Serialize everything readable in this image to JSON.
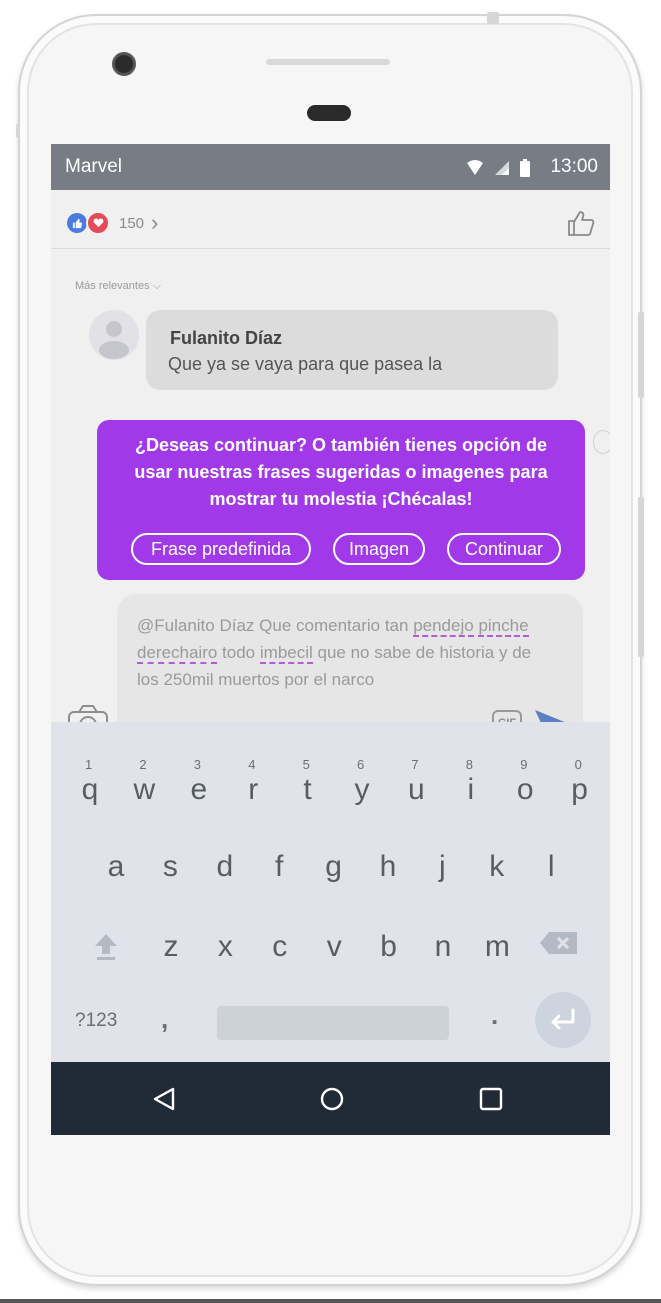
{
  "status_bar": {
    "carrier": "Marvel",
    "time": "13:00",
    "icons": [
      "wifi-icon",
      "signal-icon",
      "battery-icon"
    ]
  },
  "post": {
    "reaction_count": "150",
    "sort_label": "Más relevantes",
    "comment": {
      "author": "Fulanito Díaz",
      "text": "Que ya  se vaya para que pasea la"
    }
  },
  "popup": {
    "message": "¿Deseas continuar? O también tienes opción de usar nuestras frases sugeridas o imagenes para mostrar tu molestia ¡Chécalas!",
    "buttons": {
      "predefined": "Frase predefinida",
      "image": "Imagen",
      "continue": "Continuar"
    }
  },
  "composer": {
    "mention": "@Fulanito Díaz",
    "t1": " Que comentario tan ",
    "w1": "pendejo",
    "t2": " ",
    "w2": "pinche derechairo",
    "t3": " todo ",
    "w3": "imbecil",
    "t4": " que no sabe de historia y de los 250mil muertos  por el narco",
    "gif_label": "GIF"
  },
  "keyboard": {
    "row1": [
      "q",
      "w",
      "e",
      "r",
      "t",
      "y",
      "u",
      "i",
      "o",
      "p"
    ],
    "row1_nums": [
      "1",
      "2",
      "3",
      "4",
      "5",
      "6",
      "7",
      "8",
      "9",
      "0"
    ],
    "row2": [
      "a",
      "s",
      "d",
      "f",
      "g",
      "h",
      "j",
      "k",
      "l"
    ],
    "row3": [
      "z",
      "x",
      "c",
      "v",
      "b",
      "n",
      "m"
    ],
    "symbols_key": "?123",
    "comma": ",",
    "period": "."
  },
  "colors": {
    "popup": "#a239e8",
    "status_bar": "#777c85",
    "nav_bar": "#212b38",
    "keyboard": "#e0e4ea"
  }
}
